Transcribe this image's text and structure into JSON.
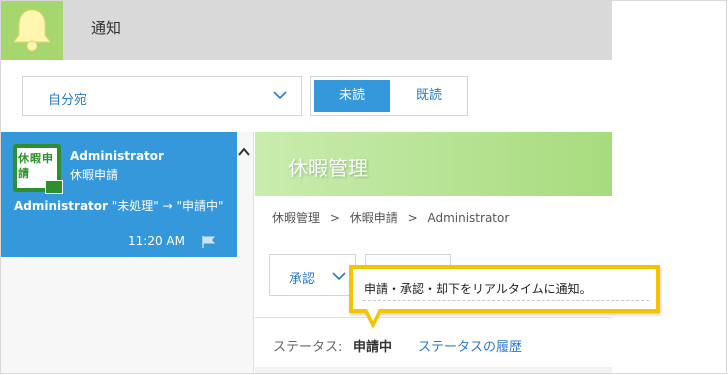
{
  "header": {
    "title": "通知"
  },
  "filter": {
    "selected": "自分宛"
  },
  "read_toggle": {
    "unread_label": "未読",
    "read_label": "既読"
  },
  "notification": {
    "icon_text": "休暇申請",
    "sender": "Administrator",
    "app_name": "休暇申請",
    "message_sender": "Administrator",
    "message_body": "\"未処理\" → \"申請中\"",
    "time": "11:20 AM"
  },
  "detail": {
    "title": "休暇管理",
    "breadcrumb": [
      "休暇管理",
      ">",
      "休暇申請",
      ">",
      "Administrator"
    ],
    "action_label": "承認",
    "status_label": "ステータス:",
    "status_value": "申請中",
    "status_history_link": "ステータスの履歴"
  },
  "callout": {
    "text": "申請・承認・却下をリアルタイムに通知。"
  },
  "colors": {
    "accent_blue": "#3498db",
    "header_green": "#a6d76f",
    "callout_yellow": "#f5c400"
  }
}
